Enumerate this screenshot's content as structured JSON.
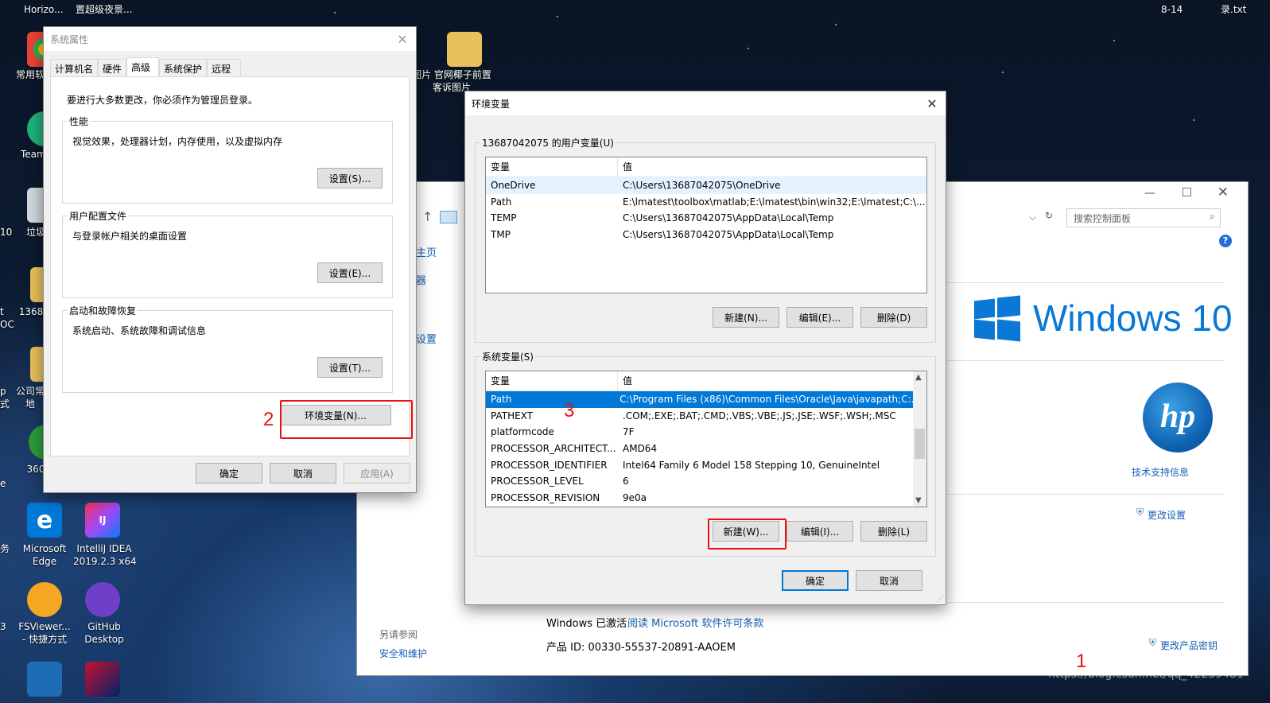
{
  "desktop": {
    "top_texts": [
      "Horizo...",
      "置超级夜景...",
      "8-14",
      "录.txt"
    ],
    "icons": [
      {
        "label": "常用软"
      },
      {
        "label": "Team"
      },
      {
        "label": "垃圾"
      },
      {
        "label": "1368"
      },
      {
        "label": "公司常\n地"
      },
      {
        "label": "360"
      },
      {
        "label": "Microsoft\nEdge"
      },
      {
        "label": "IntelliJ IDEA\n2019.2.3 x64"
      },
      {
        "label": "FSViewer...\n- 快捷方式"
      },
      {
        "label": "GitHub\nDesktop"
      },
      {
        "label": "图片 官网椰子前置\n客诉图片"
      }
    ],
    "edge_fragments": [
      "10",
      "t",
      "OC",
      "p",
      "式",
      "e",
      "务",
      "3"
    ],
    "watermark": "https://blog.csdn.net/qq_42239481"
  },
  "sysprops": {
    "title": "系统属性",
    "tabs": [
      "计算机名",
      "硬件",
      "高级",
      "系统保护",
      "远程"
    ],
    "active_tab": "高级",
    "admin_note": "要进行大多数更改，你必须作为管理员登录。",
    "perf": {
      "title": "性能",
      "desc": "视觉效果，处理器计划，内存使用，以及虚拟内存",
      "btn": "设置(S)..."
    },
    "profile": {
      "title": "用户配置文件",
      "desc": "与登录帐户相关的桌面设置",
      "btn": "设置(E)..."
    },
    "startup": {
      "title": "启动和故障恢复",
      "desc": "系统启动、系统故障和调试信息",
      "btn": "设置(T)..."
    },
    "env_btn": "环境变量(N)...",
    "ok": "确定",
    "cancel": "取消",
    "apply": "应用(A)"
  },
  "control_panel": {
    "search_placeholder": "搜索控制面板",
    "nav": [
      "主页",
      "器",
      "设置"
    ],
    "windows_brand": "Windows 10",
    "support": "技术支持信息",
    "change_settings": "更改设置",
    "activated": "Windows 已激活",
    "license_link": "阅读 Microsoft 软件许可条款",
    "product_id": "产品 ID: 00330-55537-20891-AAOEM",
    "change_key": "更改产品密钥",
    "see_also": "另请参阅",
    "security": "安全和维护"
  },
  "envvars": {
    "title": "环境变量",
    "user_group": "13687042075 的用户变量(U)",
    "col_var": "变量",
    "col_val": "值",
    "user_rows": [
      {
        "name": "OneDrive",
        "value": "C:\\Users\\13687042075\\OneDrive"
      },
      {
        "name": "Path",
        "value": "E:\\lmatest\\toolbox\\matlab;E:\\lmatest\\bin\\win32;E:\\lmatest;C:\\..."
      },
      {
        "name": "TEMP",
        "value": "C:\\Users\\13687042075\\AppData\\Local\\Temp"
      },
      {
        "name": "TMP",
        "value": "C:\\Users\\13687042075\\AppData\\Local\\Temp"
      }
    ],
    "user_btns": [
      "新建(N)...",
      "编辑(E)...",
      "删除(D)"
    ],
    "sys_group": "系统变量(S)",
    "sys_rows": [
      {
        "name": "Path",
        "value": "C:\\Program Files (x86)\\Common Files\\Oracle\\Java\\javapath;C:..."
      },
      {
        "name": "PATHEXT",
        "value": ".COM;.EXE;.BAT;.CMD;.VBS;.VBE;.JS;.JSE;.WSF;.WSH;.MSC"
      },
      {
        "name": "platformcode",
        "value": "7F"
      },
      {
        "name": "PROCESSOR_ARCHITECT...",
        "value": "AMD64"
      },
      {
        "name": "PROCESSOR_IDENTIFIER",
        "value": "Intel64 Family 6 Model 158 Stepping 10, GenuineIntel"
      },
      {
        "name": "PROCESSOR_LEVEL",
        "value": "6"
      },
      {
        "name": "PROCESSOR_REVISION",
        "value": "9e0a"
      }
    ],
    "sys_btns": [
      "新建(W)...",
      "编辑(I)...",
      "删除(L)"
    ],
    "ok": "确定",
    "cancel": "取消"
  },
  "annotations": {
    "n1": "1",
    "n2": "2",
    "n3": "3",
    "color": "#e81010"
  }
}
